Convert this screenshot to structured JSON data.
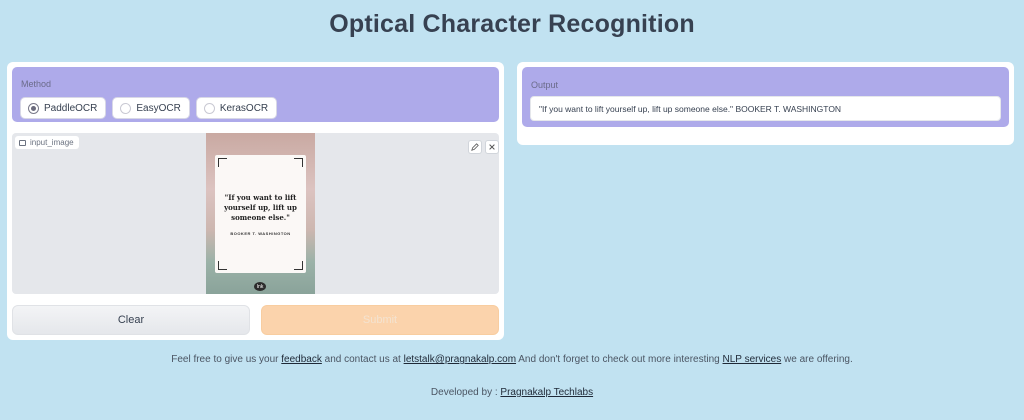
{
  "page": {
    "title": "Optical Character Recognition"
  },
  "method": {
    "label": "Method",
    "options": [
      {
        "label": "PaddleOCR",
        "checked": true
      },
      {
        "label": "EasyOCR",
        "checked": false
      },
      {
        "label": "KerasOCR",
        "checked": false
      }
    ]
  },
  "image_input": {
    "label": "input_image",
    "edit_icon": "pencil-icon",
    "close_icon": "close-icon",
    "quote": {
      "text": "\"If you want to lift yourself up, lift up someone else.\"",
      "author": "BOOKER T. WASHINGTON",
      "logo": "Ink"
    }
  },
  "buttons": {
    "clear": "Clear",
    "submit": "Submit"
  },
  "output": {
    "label": "Output",
    "value": "\"If you want to lift yourself up, lift up someone else.\" BOOKER T. WASHINGTON"
  },
  "footer": {
    "text_1": "Feel free to give us your ",
    "feedback_link": "feedback",
    "text_2": " and contact us at ",
    "email_link": "letstalk@pragnakalp.com",
    "text_3": " And don't forget to check out more interesting ",
    "nlp_link": "NLP services",
    "text_4": " we are offering.",
    "dev_prefix": "Developed by : ",
    "dev_link": "Pragnakalp Techlabs"
  },
  "colors": {
    "background": "#c1e2f1",
    "accent_box": "#aeaaea",
    "submit_bg": "#fbd3ac"
  }
}
